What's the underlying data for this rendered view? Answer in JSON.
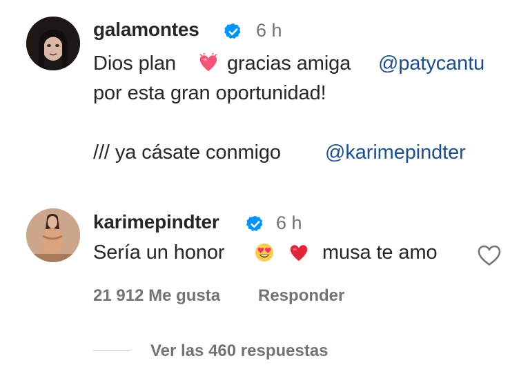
{
  "comments": [
    {
      "username": "galamontes",
      "time": "6 h",
      "line1": {
        "pre": "Dios plan",
        "emoji": "heart-with-ribbon-icon",
        "mid": "gracias amiga",
        "mention": "@patycantu"
      },
      "line2": "por esta gran oportunidad!",
      "line3": {
        "text": "/// ya cásate conmigo",
        "mention": "@karimepindter"
      }
    },
    {
      "username": "karimepindter",
      "time": "6 h",
      "text_pre": "Sería un honor",
      "emojis": [
        "heart-eyes-emoji-icon",
        "red-heart-icon"
      ],
      "text_post": "musa te amo",
      "likes": "21 912 Me gusta",
      "reply_label": "Responder",
      "view_replies": "Ver las 460 respuestas"
    }
  ],
  "colors": {
    "text": "#262626",
    "meta": "#737373",
    "mention": "#1f4e8a",
    "verified": "#0095f6"
  }
}
